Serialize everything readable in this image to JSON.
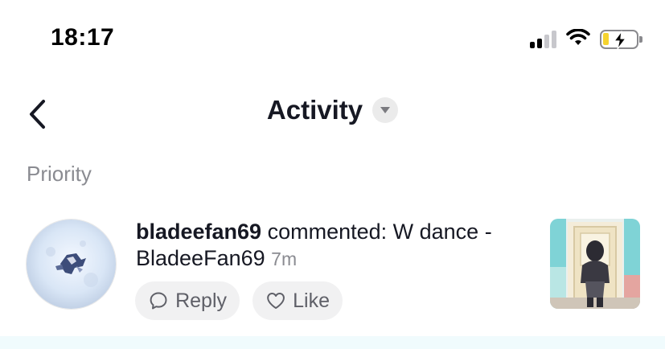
{
  "status_bar": {
    "time": "18:17",
    "icons": [
      "signal-icon",
      "wifi-icon",
      "battery-charging-icon"
    ]
  },
  "header": {
    "back_icon": "chevron-left-icon",
    "title": "Activity",
    "dropdown_icon": "caret-down-icon"
  },
  "section": {
    "label": "Priority"
  },
  "notification": {
    "username": "bladeefan69",
    "message": " commented: W dance -BladeeFan69",
    "time": "7m",
    "reply_label": "Reply",
    "like_label": "Like"
  },
  "colors": {
    "text_primary": "#161823",
    "text_secondary": "#8a8b91",
    "button_bg": "#f1f1f2",
    "highlight_row": "#f0fbfd"
  }
}
